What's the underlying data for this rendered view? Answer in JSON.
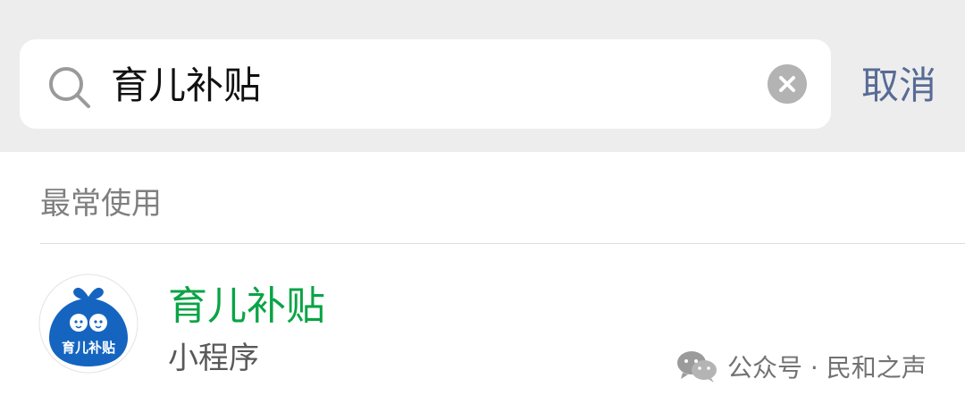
{
  "search": {
    "query": "育儿补贴",
    "cancel_label": "取消"
  },
  "section": {
    "title": "最常使用"
  },
  "result": {
    "name": "育儿补贴",
    "type": "小程序",
    "logo_text": "育儿补贴"
  },
  "watermark": {
    "text": "公众号 · 民和之声"
  },
  "colors": {
    "highlight_green": "#09a445",
    "link_blue": "#576b95",
    "logo_blue": "#1565c0"
  },
  "icons": {
    "search": "search-icon",
    "clear": "clear-icon",
    "watermark": "wechat-icon"
  }
}
